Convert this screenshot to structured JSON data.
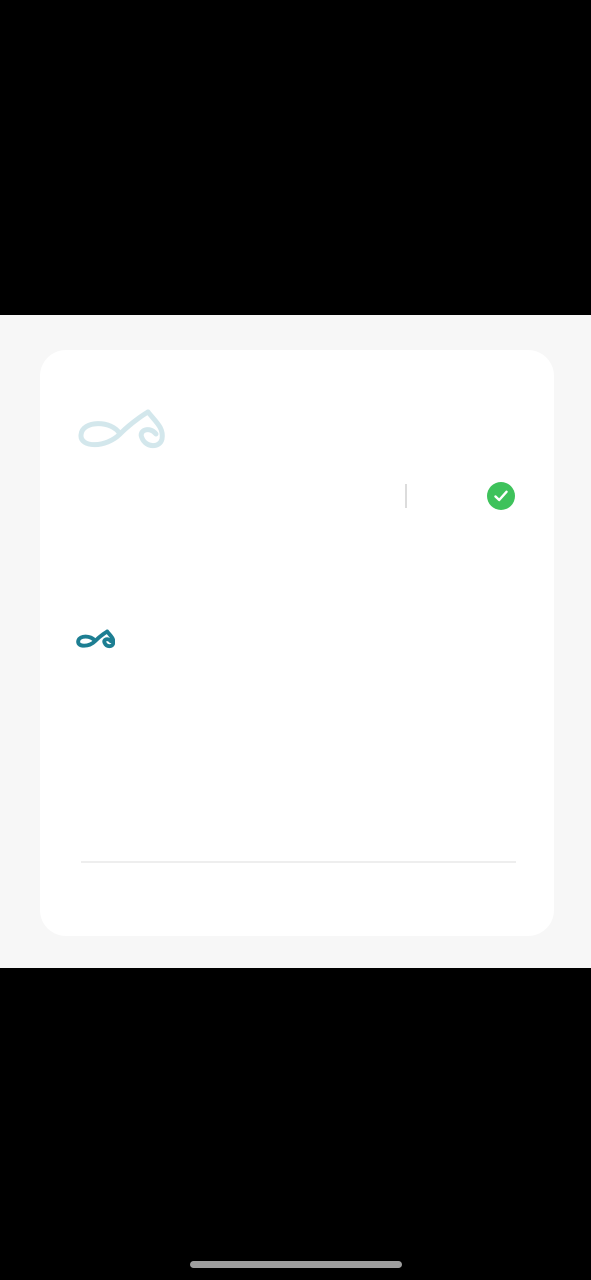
{
  "app": {
    "brand_color_light": "#d3e7ec",
    "brand_color_dark": "#1d7e92",
    "status_color": "#3ec25b"
  },
  "card": {
    "logo_large": {
      "icon": "infinity-drop-logo-icon"
    },
    "status": {
      "icon": "check-circle-icon"
    },
    "logo_small": {
      "icon": "infinity-drop-logo-icon"
    }
  }
}
